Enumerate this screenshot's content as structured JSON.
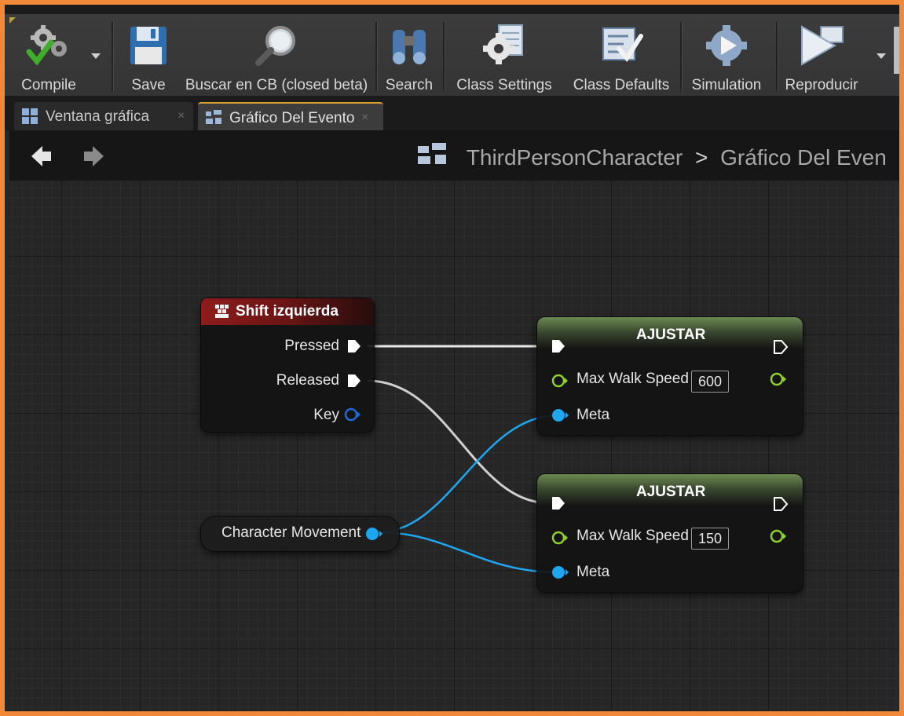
{
  "toolbar": {
    "buttons": [
      {
        "label": "Compile",
        "icon": "compile-gears-check-icon"
      },
      {
        "label": "Save",
        "icon": "floppy-disk-icon"
      },
      {
        "label": "Buscar en CB (closed beta)",
        "icon": "magnifier-icon"
      },
      {
        "label": "Search",
        "icon": "binoculars-icon"
      },
      {
        "label": "Class Settings",
        "icon": "gear-document-icon"
      },
      {
        "label": "Class Defaults",
        "icon": "checklist-icon"
      },
      {
        "label": "Simulation",
        "icon": "simulation-gear-icon"
      },
      {
        "label": "Reproducir",
        "icon": "play-icon"
      }
    ]
  },
  "tabs": [
    {
      "label": "Ventana gráfica",
      "active": false,
      "close": "×"
    },
    {
      "label": "Gráfico Del Evento",
      "active": true,
      "close": "×"
    }
  ],
  "breadcrumb": {
    "root": "ThirdPersonCharacter",
    "separator": ">",
    "current": "Gráfico Del Even"
  },
  "nodes": {
    "event": {
      "title": "Shift izquierda",
      "pins": [
        "Pressed",
        "Released",
        "Key"
      ]
    },
    "set1": {
      "title": "AJUSTAR",
      "property": "Max Walk Speed",
      "value": "600",
      "target": "Meta"
    },
    "set2": {
      "title": "AJUSTAR",
      "property": "Max Walk Speed",
      "value": "150",
      "target": "Meta"
    },
    "variable": {
      "label": "Character Movement"
    }
  },
  "colors": {
    "accent_orange": "#f08a3a",
    "exec_pin": "#ffffff",
    "object_pin": "#1ea7f0",
    "float_pin": "#8fd02a",
    "event_header": "#8e1c1c",
    "set_header": "#6c8a52"
  }
}
